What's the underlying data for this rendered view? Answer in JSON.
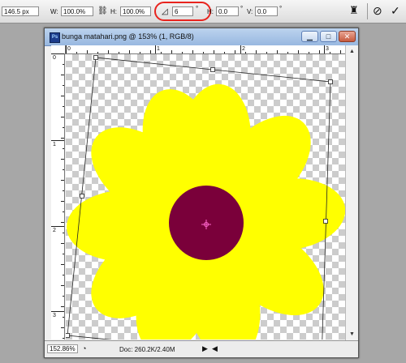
{
  "options_bar": {
    "x_value": "146.5 px",
    "w_label": "W:",
    "w_value": "100.0%",
    "h_label": "H:",
    "h_value": "100.0%",
    "rotate_value": "6",
    "degree_symbol": "°",
    "hskew_label": "H:",
    "hskew_value": "0.0",
    "vskew_label": "V:",
    "vskew_value": "0.0",
    "link_icon": "link-chain-icon",
    "rotate_icon": "rotate-angle-icon",
    "warp_icon": "warp-icon",
    "cancel_icon": "cancel-icon",
    "commit_icon": "commit-checkmark-icon",
    "highlight_color": "#e8241e"
  },
  "document": {
    "title": "bunga matahari.png @ 153% (1, RGB/8)",
    "app_icon_text": "Ps",
    "window_buttons": {
      "minimize": "▁",
      "maximize": "□",
      "close": "✕"
    },
    "ruler_top_labels": [
      "0",
      "1",
      "2",
      "3"
    ],
    "ruler_left_labels": [
      "0",
      "1",
      "2",
      "3"
    ],
    "status_zoom": "152.86%",
    "status_info": "Doc: 260.2K/2.40M",
    "status_arrow": "▶",
    "status_nav_arrow": "◀"
  },
  "artwork": {
    "petal_color": "#ffff00",
    "center_color": "#7a003a",
    "checker_color": "#cccccc",
    "bounding_box_color": "#222222"
  }
}
